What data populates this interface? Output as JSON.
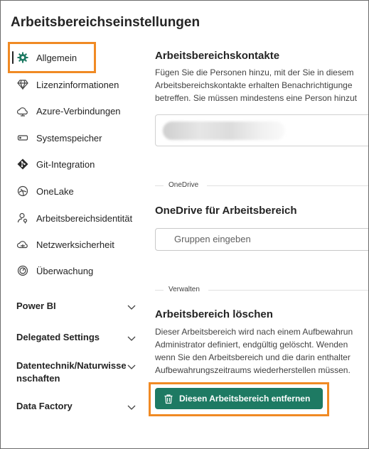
{
  "page": {
    "title": "Arbeitsbereichseinstellungen"
  },
  "sidebar": {
    "items": [
      {
        "label": "Allgemein",
        "icon": "gear-icon",
        "active": true
      },
      {
        "label": "Lizenzinformationen",
        "icon": "diamond-icon"
      },
      {
        "label": "Azure-Verbindungen",
        "icon": "cloud-icon"
      },
      {
        "label": "Systemspeicher",
        "icon": "storage-icon"
      },
      {
        "label": "Git-Integration",
        "icon": "git-icon"
      },
      {
        "label": "OneLake",
        "icon": "onelake-icon"
      },
      {
        "label": "Arbeitsbereichsidentität",
        "icon": "identity-icon"
      },
      {
        "label": "Netzwerksicherheit",
        "icon": "network-cloud-icon"
      },
      {
        "label": "Überwachung",
        "icon": "gauge-icon"
      }
    ],
    "groups": [
      {
        "label": "Power BI"
      },
      {
        "label": "Delegated Settings"
      },
      {
        "label_line1": "Datentechnik/Naturwisse",
        "label_line2": "nschaften"
      },
      {
        "label": "Data Factory"
      }
    ]
  },
  "contacts": {
    "title": "Arbeitsbereichskontakte",
    "desc_lines": [
      "Fügen Sie die Personen hinzu, mit der Sie in diesem",
      "Arbeitsbereichskontakte erhalten Benachrichtigunge",
      "betreffen. Sie müssen mindestens eine Person hinzut"
    ]
  },
  "onedrive": {
    "divider": "OneDrive",
    "title": "OneDrive für Arbeitsbereich",
    "placeholder": "Gruppen eingeben"
  },
  "manage": {
    "divider": "Verwalten",
    "title": "Arbeitsbereich löschen",
    "desc_lines": [
      "Dieser Arbeitsbereich wird nach einem Aufbewahrun",
      "Administrator definiert, endgültig gelöscht. Wenden",
      "wenn Sie den Arbeitsbereich und die darin enthalter",
      "Aufbewahrungszeitraums wiederherstellen müssen."
    ],
    "remove_button": "Diesen Arbeitsbereich entfernen"
  },
  "colors": {
    "accent": "#1e7a63",
    "highlight": "#f08a24"
  }
}
